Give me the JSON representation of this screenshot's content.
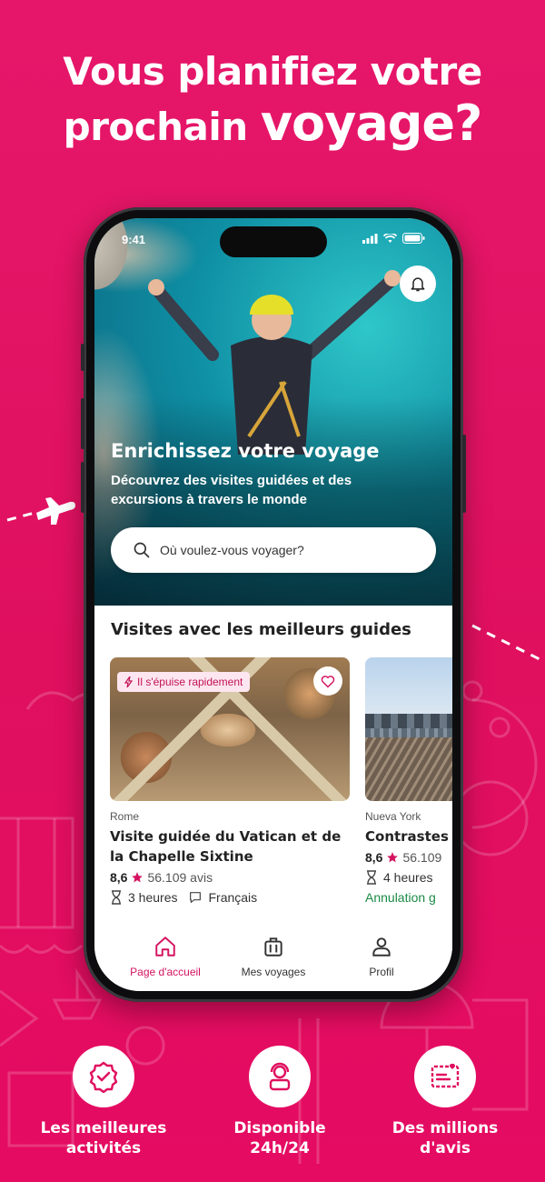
{
  "headline": {
    "line1": "Vous planifiez votre",
    "line2_a": "prochain",
    "line2_b": "voyage?"
  },
  "colors": {
    "brand": "#e0105f",
    "accent": "#d41360",
    "cancel_green": "#1a8a45"
  },
  "statusbar": {
    "time": "9:41"
  },
  "hero": {
    "title": "Enrichissez votre voyage",
    "subtitle_line1": "Découvrez des visites guidées et des",
    "subtitle_line2": "excursions à travers le monde"
  },
  "search": {
    "placeholder": "Où voulez-vous voyager?"
  },
  "section": {
    "title": "Visites avec les meilleurs guides"
  },
  "cards": [
    {
      "badge": "Il s'épuise rapidement",
      "city": "Rome",
      "title_line1": "Visite guidée du Vatican et de",
      "title_line2": "la Chapelle Sixtine",
      "score": "8,6",
      "reviews": "56.109 avis",
      "duration": "3 heures",
      "language": "Français"
    },
    {
      "city": "Nueva York",
      "title_line1": "Contrastes",
      "score": "8,6",
      "reviews": "56.109",
      "duration": "4 heures",
      "cancellation": "Annulation g"
    }
  ],
  "tabs": [
    {
      "label": "Page d'accueil",
      "icon": "home-icon",
      "active": true
    },
    {
      "label": "Mes voyages",
      "icon": "suitcase-icon",
      "active": false
    },
    {
      "label": "Profil",
      "icon": "profile-icon",
      "active": false
    }
  ],
  "features": [
    {
      "line1": "Les meilleures",
      "line2": "activités",
      "icon": "badge-check-icon"
    },
    {
      "line1": "Disponible",
      "line2": "24h/24",
      "icon": "support-agent-icon"
    },
    {
      "line1": "Des millions",
      "line2": "d'avis",
      "icon": "review-stamp-icon"
    }
  ]
}
